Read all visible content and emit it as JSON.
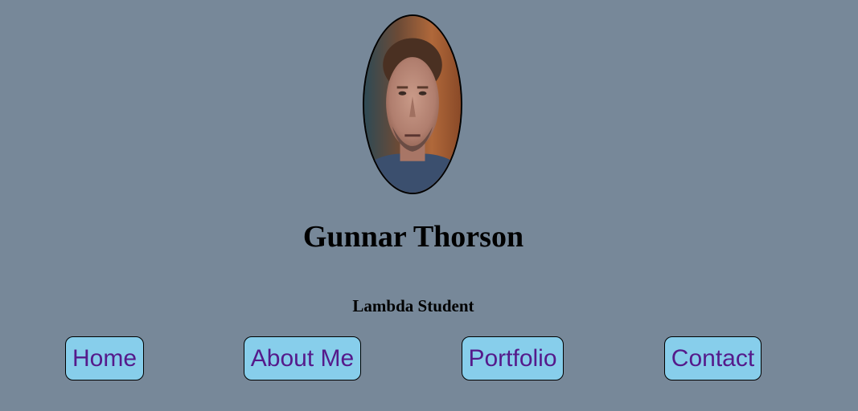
{
  "profile": {
    "name": "Gunnar Thorson",
    "subtitle": "Lambda Student"
  },
  "nav": {
    "items": [
      {
        "label": "Home"
      },
      {
        "label": "About Me"
      },
      {
        "label": "Portfolio"
      },
      {
        "label": "Contact"
      }
    ]
  },
  "colors": {
    "background": "#778899",
    "button_bg": "#87ceeb",
    "button_text": "#551a8b",
    "text": "#000000"
  }
}
